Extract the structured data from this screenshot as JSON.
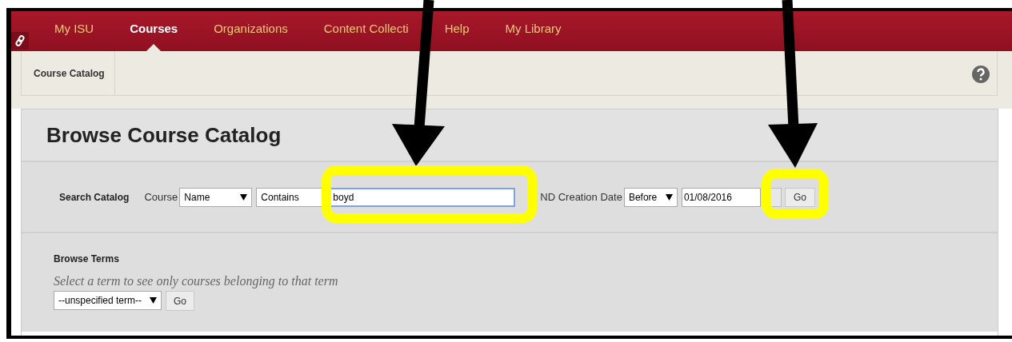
{
  "nav": {
    "items": [
      {
        "label": "My ISU",
        "selected": false
      },
      {
        "label": "Courses",
        "selected": true
      },
      {
        "label": "Organizations",
        "selected": false
      },
      {
        "label": "Content Collecti",
        "selected": false
      },
      {
        "label": "Help",
        "selected": false
      },
      {
        "label": "My Library",
        "selected": false
      }
    ]
  },
  "breadcrumb": {
    "items": [
      "Course Catalog"
    ]
  },
  "page_title": "Browse Course Catalog",
  "search": {
    "label": "Search Catalog",
    "field_label": "Course",
    "field": "Name",
    "operator": "Contains",
    "query": "boyd",
    "query_focused": true,
    "date_label": "ND Creation Date",
    "date_operator": "Before",
    "date": "01/08/2016",
    "button": "Go"
  },
  "terms": {
    "title": "Browse Terms",
    "hint": "Select a term to see only courses belonging to that term",
    "term": "--unspecified term--",
    "button": "Go"
  }
}
